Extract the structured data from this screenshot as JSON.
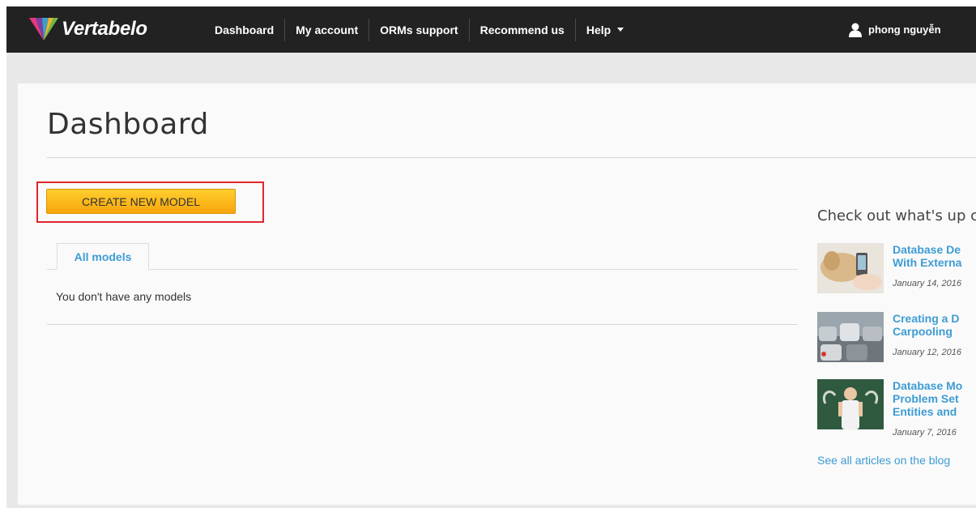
{
  "brand": {
    "name": "Vertabelo"
  },
  "nav": {
    "items": [
      {
        "label": "Dashboard"
      },
      {
        "label": "My account"
      },
      {
        "label": "ORMs support"
      },
      {
        "label": "Recommend us"
      },
      {
        "label": "Help"
      }
    ],
    "user_name": "phong nguyễn"
  },
  "main": {
    "title": "Dashboard",
    "create_button": "CREATE NEW MODEL",
    "tabs": [
      {
        "label": "All models"
      }
    ],
    "empty_message": "You don't have any models"
  },
  "sidebar": {
    "heading": "Check out what's up c",
    "articles": [
      {
        "title_line1": "Database De",
        "title_line2": "With Externa",
        "date": "January 14, 2016"
      },
      {
        "title_line1": "Creating a D",
        "title_line2": "Carpooling",
        "date": "January 12, 2016"
      },
      {
        "title_line1": "Database Mo",
        "title_line2": "Problem Set",
        "title_line3": "Entities and",
        "date": "January 7, 2016"
      }
    ],
    "see_all": "See all articles on the blog"
  },
  "colors": {
    "nav_bg": "#222222",
    "accent": "#3d9cd4",
    "button": "#f7a50c",
    "highlight": "#e0262c"
  }
}
